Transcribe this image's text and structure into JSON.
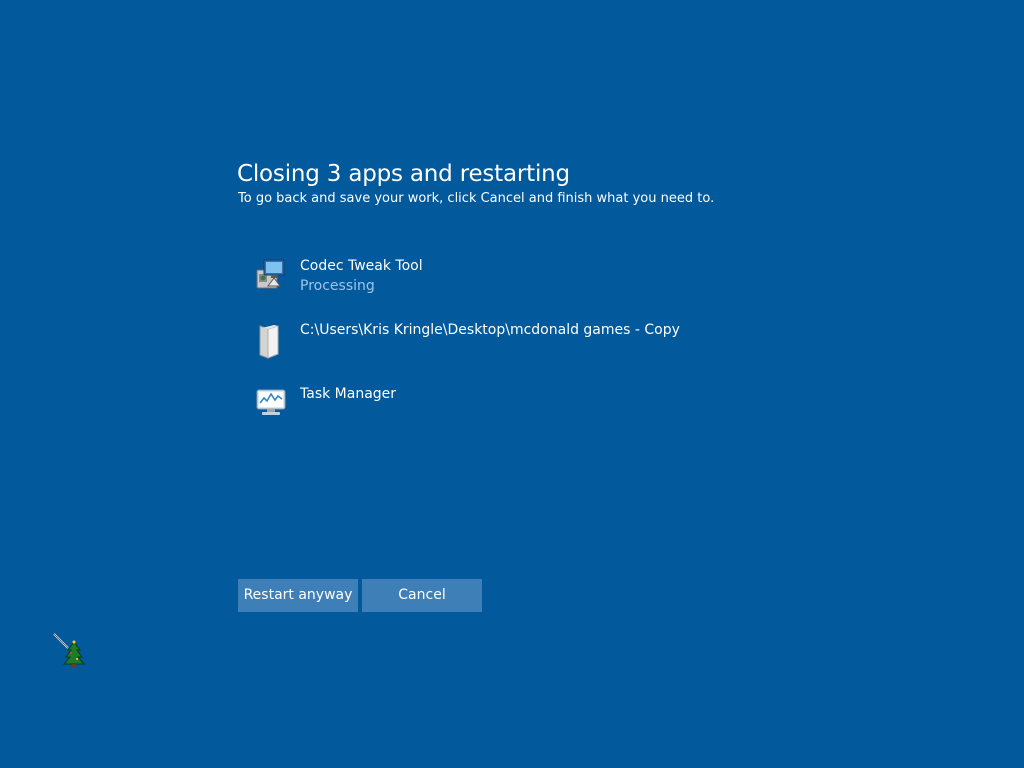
{
  "dialog": {
    "title": "Closing 3 apps and restarting",
    "subtitle": "To go back and save your work, click Cancel and finish what you need to."
  },
  "apps": [
    {
      "name": "Codec Tweak Tool",
      "status": "Processing",
      "icon": "installer-icon"
    },
    {
      "name": "C:\\Users\\Kris Kringle\\Desktop\\mcdonald games - Copy",
      "status": "",
      "icon": "folder-icon"
    },
    {
      "name": "Task Manager",
      "status": "",
      "icon": "task-manager-icon"
    }
  ],
  "buttons": {
    "restart_label": "Restart anyway",
    "cancel_label": "Cancel"
  },
  "colors": {
    "background": "#02599c",
    "button": "#3f7fb7",
    "status_text": "#9cc7ec"
  },
  "cursor": {
    "icon": "christmas-tree-cursor-icon"
  }
}
